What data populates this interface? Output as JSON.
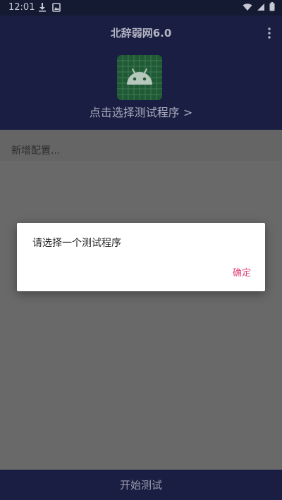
{
  "status_bar": {
    "time": "12:01",
    "left_icons": [
      "download-icon",
      "image-notification-icon"
    ],
    "right_icons": [
      "wifi-icon",
      "signal-icon",
      "battery-icon"
    ]
  },
  "header": {
    "title": "北辞弱网6.0",
    "menu_icon": "more-vert-icon",
    "app_icon": "android-icon",
    "select_program_label": "点击选择测试程序 >"
  },
  "config": {
    "add_label": "新增配置..."
  },
  "dialog": {
    "message": "请选择一个测试程序",
    "ok_label": "确定"
  },
  "bottom_bar": {
    "start_label": "开始测试"
  },
  "colors": {
    "header_bg": "#191e42",
    "dialog_accent": "#e0457b",
    "scrim": "#696969",
    "icon_bg": "#1f5a35"
  }
}
